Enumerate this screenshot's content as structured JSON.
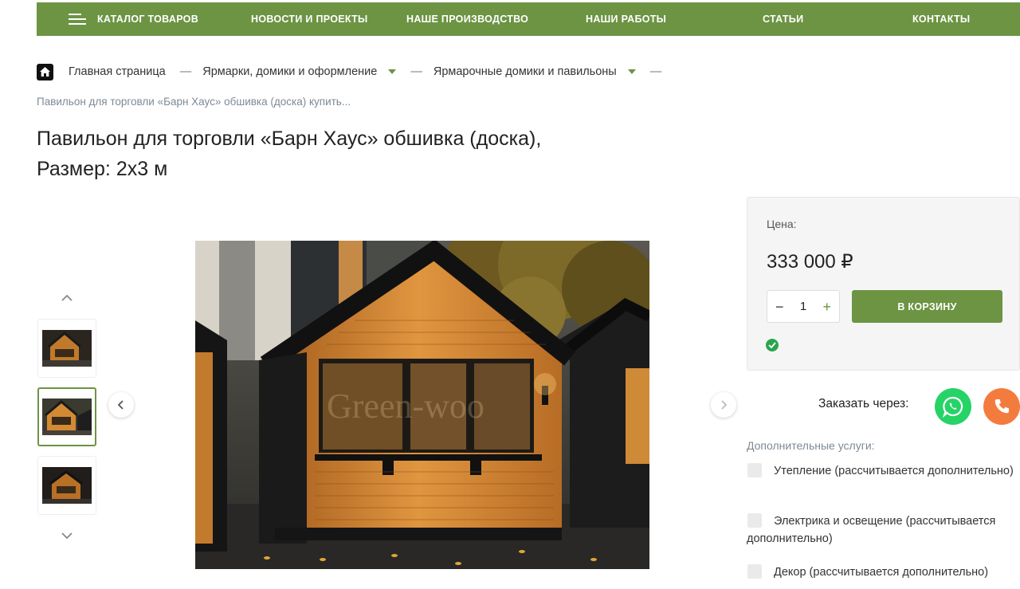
{
  "nav": {
    "catalog": "КАТАЛОГ ТОВАРОВ",
    "news": "НОВОСТИ И ПРОЕКТЫ",
    "production": "НАШЕ ПРОИЗВОДСТВО",
    "works": "НАШИ РАБОТЫ",
    "articles": "СТАТЬИ",
    "contacts": "КОНТАКТЫ"
  },
  "breadcrumb": {
    "home": "Главная страница",
    "sep": "—",
    "level1": "Ярмарки, домики и оформление",
    "level2": "Ярмарочные домики и павильоны",
    "current": "Павильон для торговли «Барн Хаус» обшивка (доска) купить..."
  },
  "product": {
    "title_line1": "Павильон для торговли «Барн Хаус» обшивка (доска),",
    "title_line2": "Размер: 2х3 м",
    "watermark": "Green-woo"
  },
  "price_box": {
    "label": "Цена:",
    "value": "333 000 ₽",
    "qty_minus": "−",
    "qty_value": "1",
    "qty_plus": "+",
    "cart_button": "В КОРЗИНУ"
  },
  "order": {
    "label": "Заказать через:"
  },
  "extras": {
    "label": "Дополнительные услуги:",
    "items": [
      "Утепление (рассчитывается дополнительно)",
      "Электрика и освещение (рассчитывается дополнительно)",
      "Декор (рассчитывается дополнительно)"
    ]
  },
  "colors": {
    "brand_green": "#6c9443",
    "whatsapp": "#25d366",
    "phone": "#f47b3e",
    "stock_green": "#2ba54d"
  }
}
